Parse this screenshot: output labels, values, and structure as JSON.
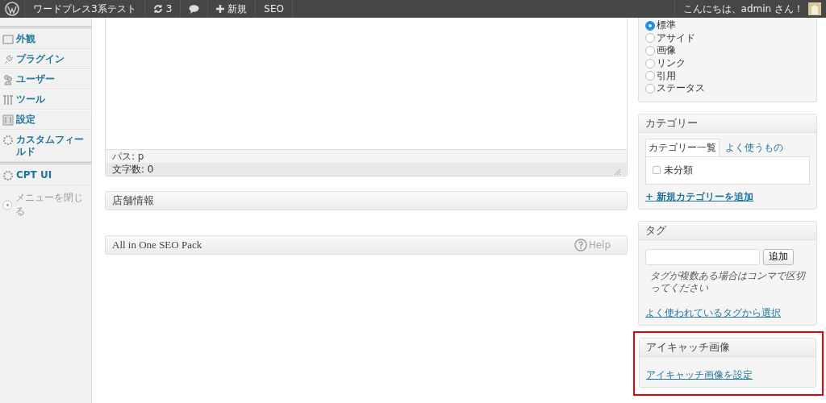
{
  "admin_bar": {
    "site": "ワードプレス3系テスト",
    "updates": "3",
    "new": "新規",
    "seo": "SEO",
    "greeting": "こんにちは、admin さん！"
  },
  "sidebar": {
    "items": [
      {
        "label": "外観"
      },
      {
        "label": "プラグイン"
      },
      {
        "label": "ユーザー"
      },
      {
        "label": "ツール"
      },
      {
        "label": "設定"
      },
      {
        "label": "カスタムフィールド"
      },
      {
        "label": "CPT UI"
      }
    ],
    "collapse": "メニューを閉じる"
  },
  "editor": {
    "path": "パス: p",
    "word_count": "文字数: 0"
  },
  "metaboxes": [
    {
      "title": "店舗情報",
      "help": false
    },
    {
      "title": "All in One SEO Pack",
      "help": "Help"
    }
  ],
  "format": {
    "options": [
      {
        "label": "標準",
        "selected": true
      },
      {
        "label": "アサイド",
        "selected": false
      },
      {
        "label": "画像",
        "selected": false
      },
      {
        "label": "リンク",
        "selected": false
      },
      {
        "label": "引用",
        "selected": false
      },
      {
        "label": "ステータス",
        "selected": false
      }
    ]
  },
  "category": {
    "title": "カテゴリー",
    "tabs": [
      {
        "label": "カテゴリー一覧",
        "selected": true
      },
      {
        "label": "よく使うもの",
        "selected": false
      }
    ],
    "items": [
      {
        "label": "未分類",
        "checked": false
      }
    ],
    "add_link": "+ 新規カテゴリーを追加"
  },
  "tags": {
    "title": "タグ",
    "button": "追加",
    "hint": "タグが複数ある場合はコンマで区切ってください",
    "link": "よく使われているタグから選択"
  },
  "featured_image": {
    "title": "アイキャッチ画像",
    "link": "アイキャッチ画像を設定",
    "highlighted": true
  }
}
